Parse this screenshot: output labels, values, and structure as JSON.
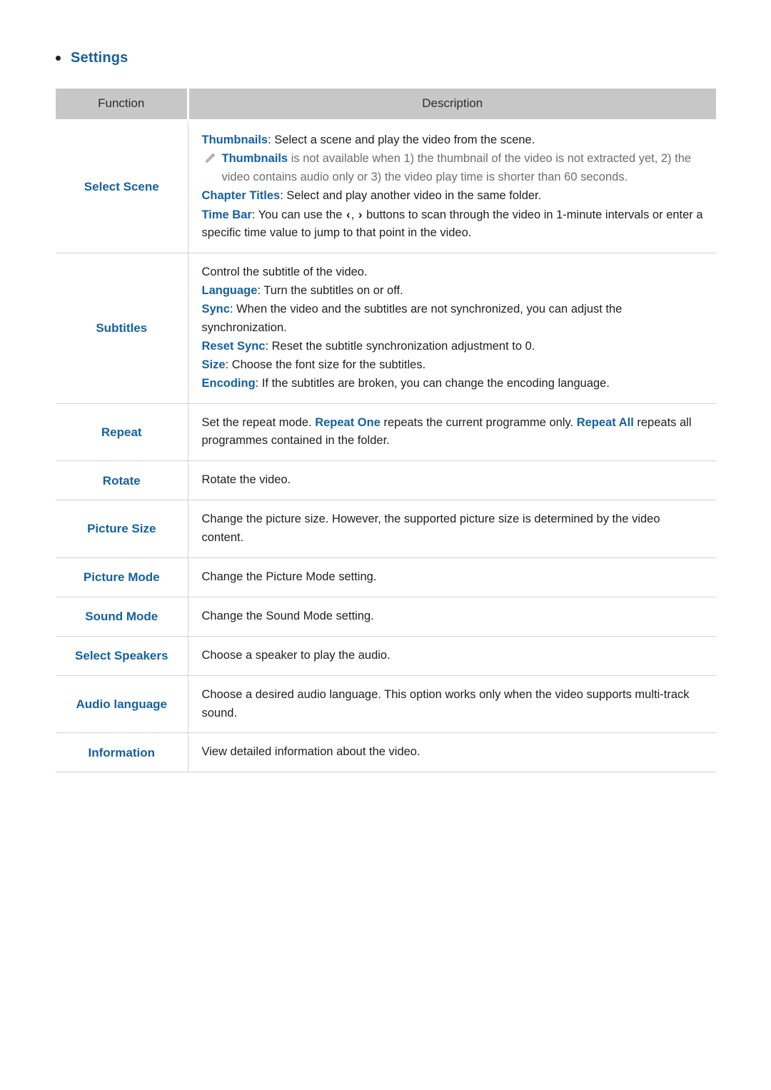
{
  "section": {
    "bullet_icon": "bullet-dot",
    "title": "Settings"
  },
  "table": {
    "columns": {
      "function": "Function",
      "description": "Description"
    },
    "rows": [
      {
        "function": "Select Scene",
        "lines": [
          {
            "keyword": "Thumbnails",
            "sep": ": ",
            "text": "Select a scene and play the video from the scene."
          },
          {
            "type": "note",
            "icon": "pencil-icon",
            "keyword": "Thumbnails",
            "sep": " ",
            "text": "is not available when 1) the thumbnail of the video is not extracted yet, 2) the video contains audio only or 3) the video play time is shorter than 60 seconds."
          },
          {
            "keyword": "Chapter Titles",
            "sep": ": ",
            "text": "Select and play another video in the same folder."
          },
          {
            "keyword": "Time Bar",
            "sep": ": ",
            "text_before": "You can use the ",
            "chevron_left": "‹",
            "chevron_comma": ", ",
            "chevron_right": "›",
            "text_after": " buttons to scan through the video in 1-minute intervals or enter a specific time value to jump to that point in the video."
          }
        ]
      },
      {
        "function": "Subtitles",
        "lines": [
          {
            "text": "Control the subtitle of the video."
          },
          {
            "keyword": "Language",
            "sep": ": ",
            "text": "Turn the subtitles on or off."
          },
          {
            "keyword": "Sync",
            "sep": ": ",
            "text": "When the video and the subtitles are not synchronized, you can adjust the synchronization."
          },
          {
            "keyword": "Reset Sync",
            "sep": ": ",
            "text": "Reset the subtitle synchronization adjustment to 0."
          },
          {
            "keyword": "Size",
            "sep": ": ",
            "text": "Choose the font size for the subtitles."
          },
          {
            "keyword": "Encoding",
            "sep": ": ",
            "text": "If the subtitles are broken, you can change the encoding language."
          }
        ]
      },
      {
        "function": "Repeat",
        "rich": {
          "part1": "Set the repeat mode. ",
          "kw1": "Repeat One",
          "part2": " repeats the current programme only. ",
          "kw2": "Repeat All",
          "part3": " repeats all programmes contained in the folder."
        }
      },
      {
        "function": "Rotate",
        "lines": [
          {
            "text": "Rotate the video."
          }
        ]
      },
      {
        "function": "Picture Size",
        "lines": [
          {
            "text": "Change the picture size. However, the supported picture size is determined by the video content."
          }
        ]
      },
      {
        "function": "Picture Mode",
        "lines": [
          {
            "text": "Change the Picture Mode setting."
          }
        ]
      },
      {
        "function": "Sound Mode",
        "lines": [
          {
            "text": "Change the Sound Mode setting."
          }
        ]
      },
      {
        "function": "Select Speakers",
        "lines": [
          {
            "text": "Choose a speaker to play the audio."
          }
        ]
      },
      {
        "function": "Audio language",
        "lines": [
          {
            "text": "Choose a desired audio language. This option works only when the video supports multi-track sound."
          }
        ]
      },
      {
        "function": "Information",
        "lines": [
          {
            "text": "View detailed information about the video."
          }
        ]
      }
    ]
  },
  "colors": {
    "accent_blue": "#15619f",
    "header_gray": "#c7c7c7",
    "border_gray": "#d3d3d3",
    "note_gray": "#6e6e73",
    "body_text": "#1f1f1f"
  }
}
